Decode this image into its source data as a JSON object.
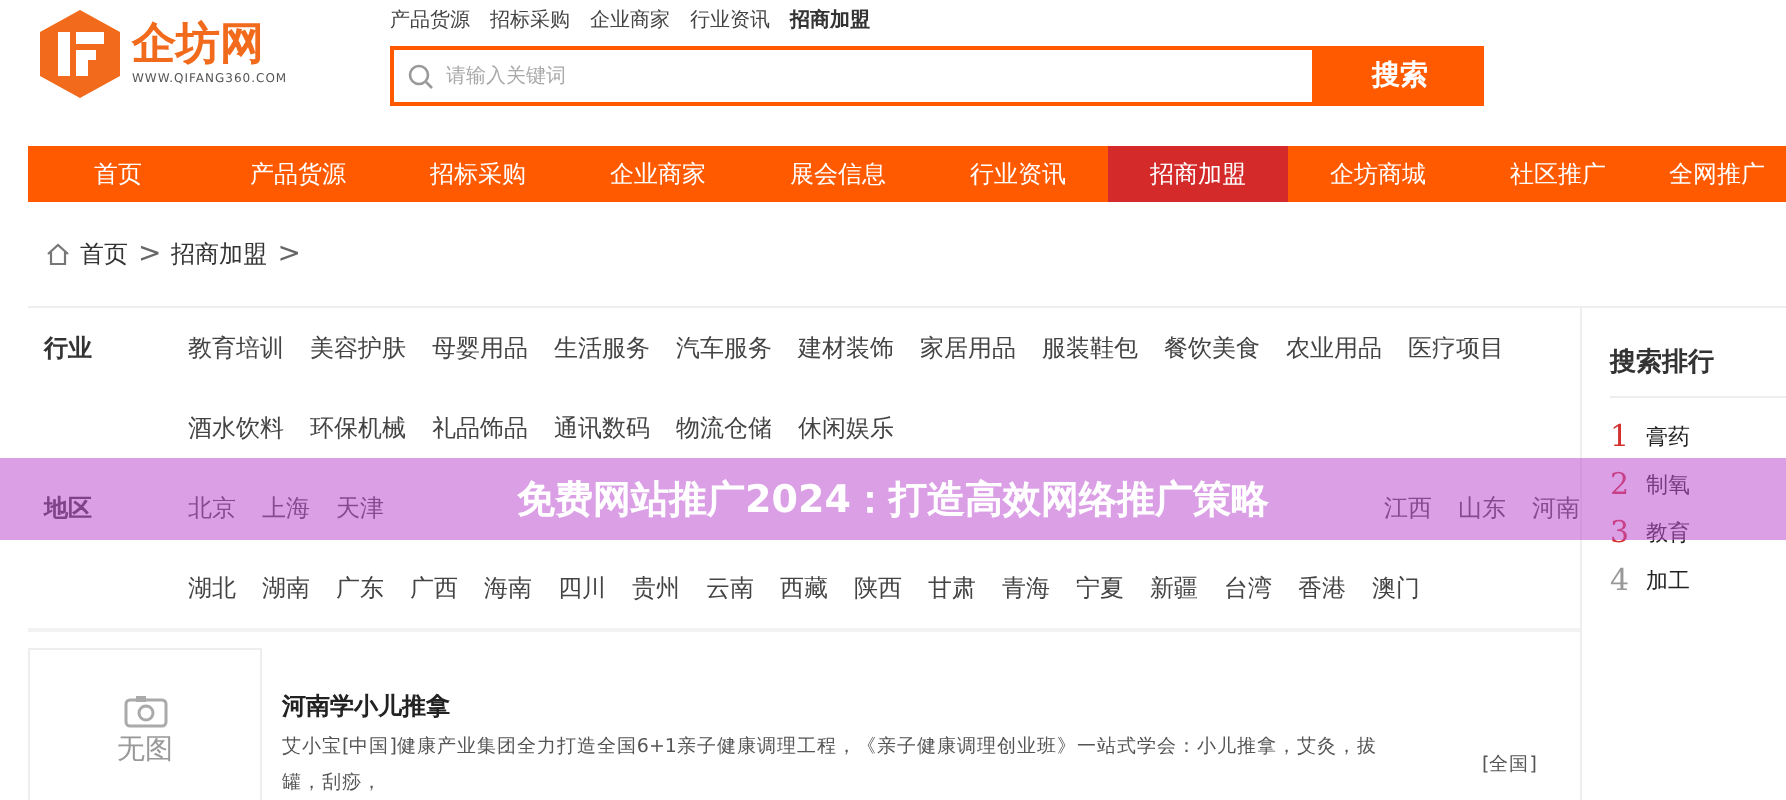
{
  "logo": {
    "name": "企坊网",
    "url": "WWW.QIFANG360.COM"
  },
  "top_links": [
    {
      "label": "产品货源",
      "selected": false
    },
    {
      "label": "招标采购",
      "selected": false
    },
    {
      "label": "企业商家",
      "selected": false
    },
    {
      "label": "行业资讯",
      "selected": false
    },
    {
      "label": "招商加盟",
      "selected": true
    }
  ],
  "search": {
    "placeholder": "请输入关键词",
    "button": "搜索"
  },
  "nav": [
    {
      "label": "首页",
      "selected": false
    },
    {
      "label": "产品货源",
      "selected": false
    },
    {
      "label": "招标采购",
      "selected": false
    },
    {
      "label": "企业商家",
      "selected": false
    },
    {
      "label": "展会信息",
      "selected": false
    },
    {
      "label": "行业资讯",
      "selected": false
    },
    {
      "label": "招商加盟",
      "selected": true
    },
    {
      "label": "企坊商城",
      "selected": false
    },
    {
      "label": "社区推广",
      "selected": false
    },
    {
      "label": "全网推广",
      "selected": false
    }
  ],
  "breadcrumb": [
    {
      "label": "首页",
      "separator": ">"
    },
    {
      "label": "招商加盟",
      "separator": ">"
    }
  ],
  "filters": [
    {
      "label": "行业",
      "rows": [
        {
          "items": [
            "教育培训",
            "美容护肤",
            "母婴用品",
            "生活服务",
            "汽车服务",
            "建材装饰",
            "家居用品",
            "服装鞋包",
            "餐饮美食",
            "农业用品",
            "医疗项目"
          ]
        },
        {
          "items": [
            "酒水饮料",
            "环保机械",
            "礼品饰品",
            "通讯数码",
            "物流仓储",
            "休闲娱乐"
          ]
        }
      ]
    },
    {
      "label": "地区",
      "rows": [
        {
          "items": [
            "北京",
            "上海",
            "天津"
          ],
          "trailing": [
            "江西",
            "山东",
            "河南"
          ]
        },
        {
          "items": [
            "湖北",
            "湖南",
            "广东",
            "广西",
            "海南",
            "四川",
            "贵州",
            "云南",
            "西藏",
            "陕西",
            "甘肃",
            "青海",
            "宁夏",
            "新疆",
            "台湾",
            "香港",
            "澳门"
          ]
        }
      ]
    }
  ],
  "listing": {
    "image_label": "无图",
    "title": "河南学小儿推拿",
    "description": "艾小宝[中国]健康产业集团全力打造全国6+1亲子健康调理工程，《亲子健康调理创业班》一站式学会：小儿推拿，艾灸，拔罐，刮痧，",
    "region": "[全国]"
  },
  "ranking": {
    "title": "搜索排行",
    "items": [
      {
        "rank": "1",
        "label": "膏药"
      },
      {
        "rank": "2",
        "label": "制氧"
      },
      {
        "rank": "3",
        "label": "教育"
      },
      {
        "rank": "4",
        "label": "加工"
      }
    ]
  },
  "banner": "免费网站推广2024：打造高效网络推广策略"
}
